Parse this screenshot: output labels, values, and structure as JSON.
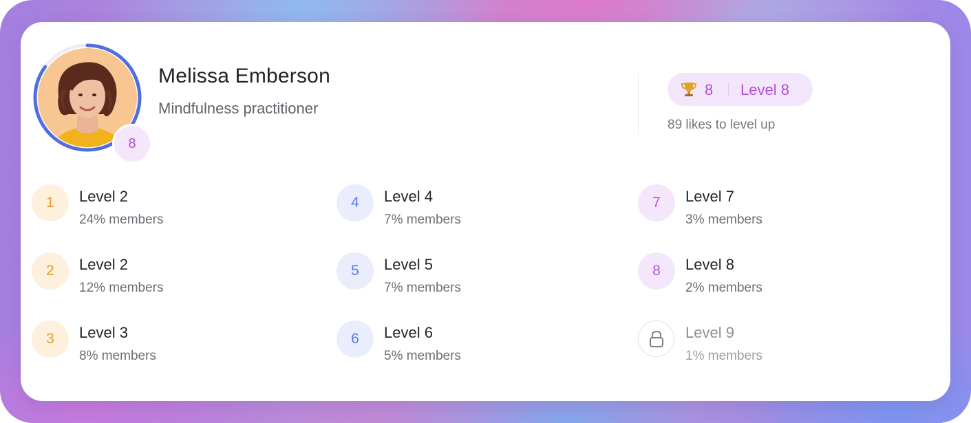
{
  "profile": {
    "name": "Melissa Emberson",
    "subtitle": "Mindfulness practitioner",
    "avatar_badge": "8",
    "avatar_progress": 0.85
  },
  "status": {
    "trophy_icon": "trophy-icon",
    "trophy_count": "8",
    "level_label": "Level 8",
    "likes_note": "89 likes to level up"
  },
  "levels": [
    {
      "badge": "1",
      "title": "Level 2",
      "members": "24% members",
      "tone": "orange",
      "locked": false
    },
    {
      "badge": "2",
      "title": "Level 2",
      "members": "12% members",
      "tone": "orange",
      "locked": false
    },
    {
      "badge": "3",
      "title": "Level 3",
      "members": "8% members",
      "tone": "orange",
      "locked": false
    },
    {
      "badge": "4",
      "title": "Level 4",
      "members": "7% members",
      "tone": "blue",
      "locked": false
    },
    {
      "badge": "5",
      "title": "Level 5",
      "members": "7% members",
      "tone": "blue",
      "locked": false
    },
    {
      "badge": "6",
      "title": "Level 6",
      "members": "5% members",
      "tone": "blue",
      "locked": false
    },
    {
      "badge": "7",
      "title": "Level 7",
      "members": "3% members",
      "tone": "purple",
      "locked": false
    },
    {
      "badge": "8",
      "title": "Level 8",
      "members": "2% members",
      "tone": "purple",
      "locked": false
    },
    {
      "badge": "",
      "title": "Level 9",
      "members": "1% members",
      "tone": "lock",
      "locked": true,
      "icon": "lock-icon"
    }
  ],
  "colors": {
    "accent_purple": "#b14fd6",
    "ring_blue": "#4f6fe0",
    "orange": "#e69b35",
    "blue": "#5e78e6"
  }
}
